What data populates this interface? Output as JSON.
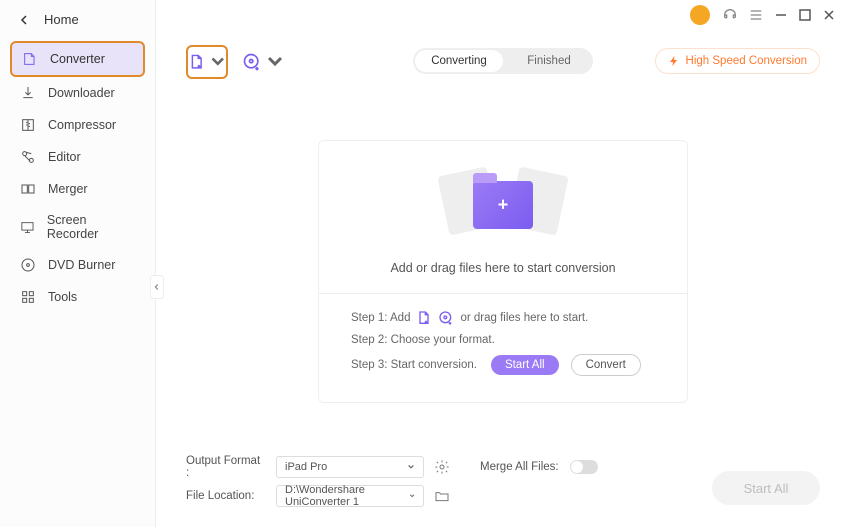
{
  "home": "Home",
  "sidebar": {
    "items": [
      {
        "label": "Converter"
      },
      {
        "label": "Downloader"
      },
      {
        "label": "Compressor"
      },
      {
        "label": "Editor"
      },
      {
        "label": "Merger"
      },
      {
        "label": "Screen Recorder"
      },
      {
        "label": "DVD Burner"
      },
      {
        "label": "Tools"
      }
    ]
  },
  "tabs": {
    "converting": "Converting",
    "finished": "Finished"
  },
  "hsc": "High Speed Conversion",
  "dropzone": {
    "message": "Add or drag files here to start conversion",
    "step1a": "Step 1: Add",
    "step1b": "or drag files here to start.",
    "step2": "Step 2: Choose your format.",
    "step3": "Step 3: Start conversion.",
    "startAll": "Start All",
    "convert": "Convert"
  },
  "footer": {
    "outputFormat": "Output Format :",
    "outputValue": "iPad Pro",
    "fileLocation": "File Location:",
    "fileValue": "D:\\Wondershare UniConverter 1",
    "mergeAll": "Merge All Files:",
    "startAll": "Start All"
  }
}
